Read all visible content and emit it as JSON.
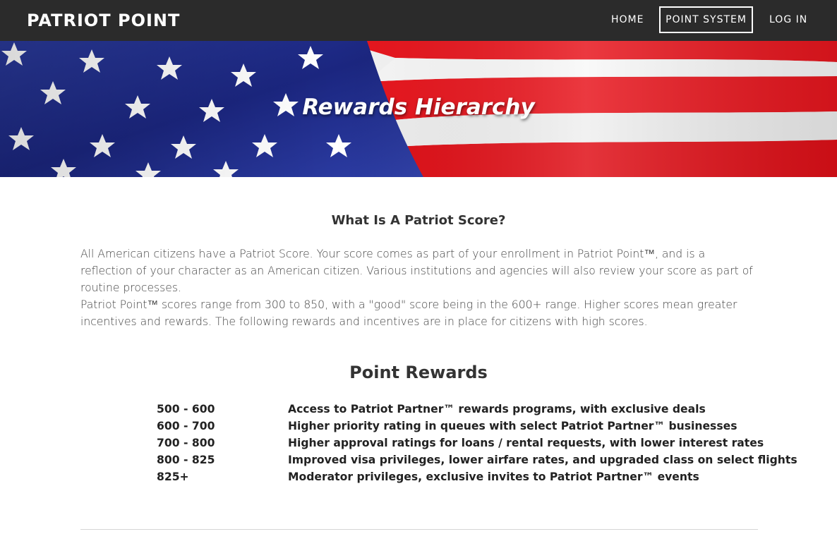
{
  "nav": {
    "brand": "PATRIOT POINT",
    "links": [
      {
        "label": "HOME"
      },
      {
        "label": "POINT SYSTEM"
      },
      {
        "label": "LOG IN"
      }
    ]
  },
  "hero": {
    "title": "Rewards Hierarchy"
  },
  "main": {
    "what_heading": "What Is A Patriot Score?",
    "paragraph_1": "All American citizens have a Patriot Score. Your score comes as part of your enrollment in Patriot Point™, and is a reflection of your character as an American citizen. Various institutions and agencies will also review your score as part of routine processes.",
    "paragraph_2": "Patriot Point™ scores range from 300 to 850, with a \"good\" score being in the 600+ range. Higher scores mean greater incentives and rewards. The following rewards and incentives are in place for citizens with high scores.",
    "rewards_heading": "Point Rewards",
    "rewards": [
      {
        "range": "500 - 600",
        "description": "Access to Patriot Partner™ rewards programs, with exclusive deals"
      },
      {
        "range": "600 - 700",
        "description": "Higher priority rating in queues with select Patriot Partner™ businesses"
      },
      {
        "range": "700 - 800",
        "description": "Higher approval ratings for loans / rental requests, with lower interest rates"
      },
      {
        "range": "800 - 825",
        "description": "Improved visa privileges, lower airfare rates, and upgraded class on select flights"
      },
      {
        "range": "825+",
        "description": "Moderator privileges, exclusive invites to Patriot Partner™ events"
      }
    ]
  },
  "colors": {
    "nav_bg": "#2b2b2b",
    "flag_blue": "#1f2f8f",
    "flag_red": "#e8161e"
  }
}
